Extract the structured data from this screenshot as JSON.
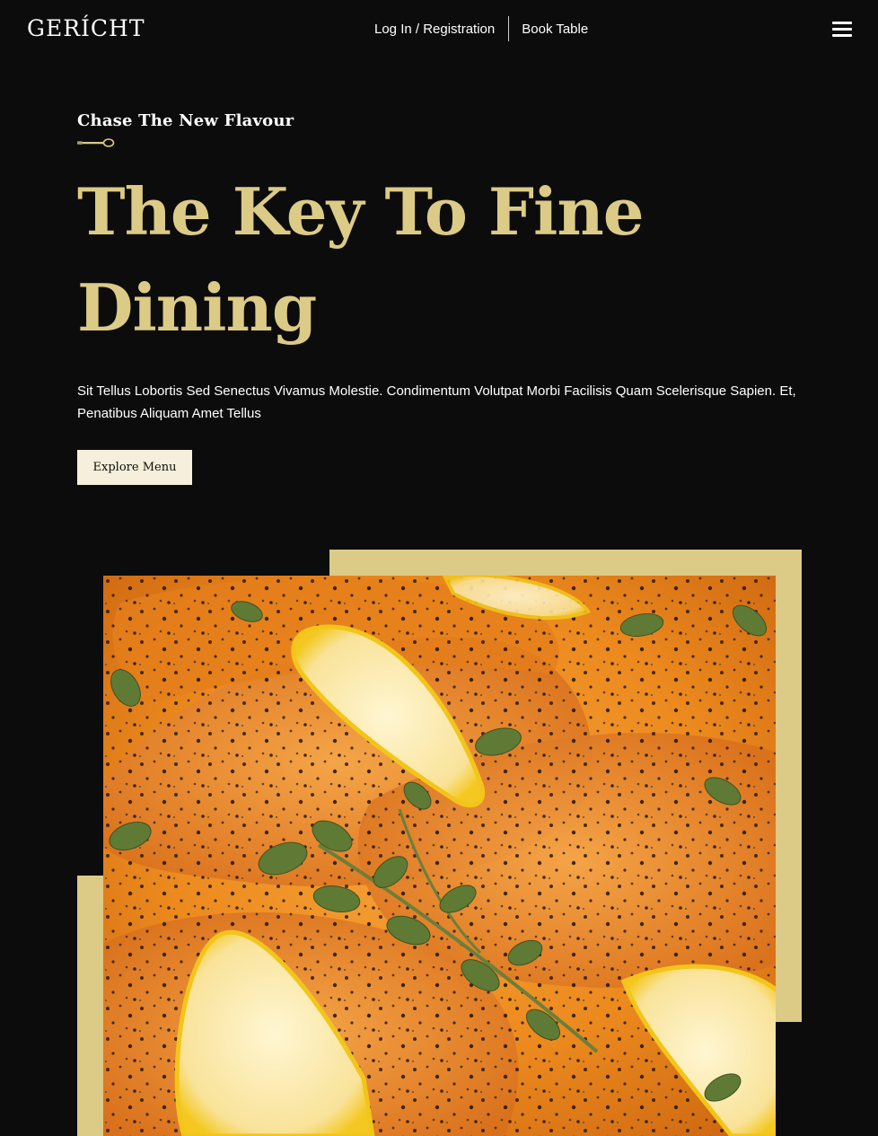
{
  "navbar": {
    "logo": "GERÍCHT",
    "login_label": "Log In / Registration",
    "book_label": "Book Table"
  },
  "hero": {
    "subtitle": "Chase The New Flavour",
    "headline_line1": "The Key To Fine",
    "headline_line2": "Dining",
    "description": "Sit Tellus Lobortis Sed Senectus Vivamus Molestie. Condimentum Volutpat Morbi Facilisis Quam Scelerisque Sapien. Et, Penatibus Aliquam Amet Tellus",
    "button_label": "Explore Menu"
  },
  "colors": {
    "background": "#0c0c0c",
    "gold": "#dcca87",
    "button_bg": "#f5efdb"
  },
  "icons": {
    "menu": "hamburger-icon",
    "divider": "spoon-icon"
  }
}
